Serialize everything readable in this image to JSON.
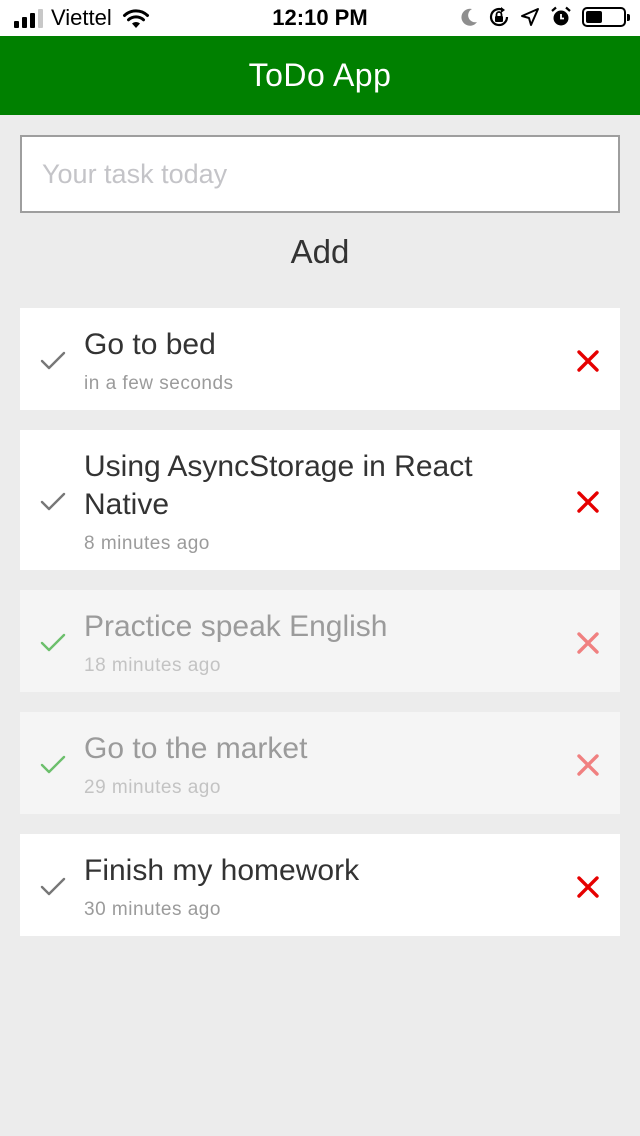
{
  "status_bar": {
    "carrier": "Viettel",
    "time": "12:10 PM",
    "signal_bars_active": 3,
    "battery_level": 0.45
  },
  "header": {
    "title": "ToDo App",
    "background": "#008000"
  },
  "input": {
    "placeholder": "Your task today",
    "value": ""
  },
  "add_button": {
    "label": "Add"
  },
  "tasks": [
    {
      "title": "Go to bed",
      "time": "in a few seconds",
      "completed": false
    },
    {
      "title": "Using AsyncStorage in React Native",
      "time": "8 minutes ago",
      "completed": false
    },
    {
      "title": "Practice speak English",
      "time": "18 minutes ago",
      "completed": true
    },
    {
      "title": "Go to the market",
      "time": "29 minutes ago",
      "completed": true
    },
    {
      "title": "Finish my homework",
      "time": "30 minutes ago",
      "completed": false
    }
  ],
  "colors": {
    "check_active": "#777777",
    "check_done": "#6cbf6c",
    "delete_active": "#e60000",
    "delete_done": "#f08080"
  }
}
